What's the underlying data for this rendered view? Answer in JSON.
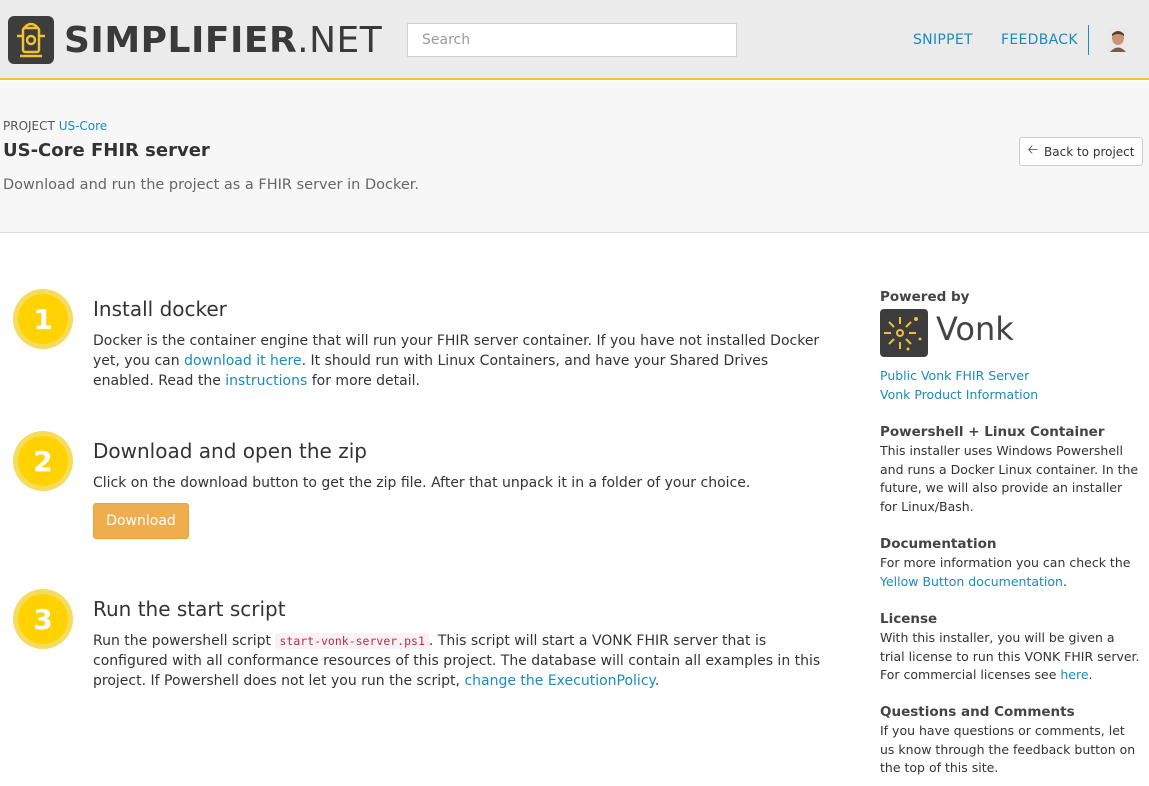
{
  "header": {
    "logo_bold": "SIMPLIFIER",
    "logo_light": ".NET",
    "search_placeholder": "Search",
    "nav": {
      "snippet": "SNIPPET",
      "feedback": "FEEDBACK"
    },
    "icons": {
      "logo": "hydrant-logo-icon",
      "avatar": "user-avatar"
    }
  },
  "project": {
    "crumb_label": "PROJECT",
    "crumb_link": "US-Core",
    "title": "US-Core FHIR server",
    "subtitle": "Download and run the project as a FHIR server in Docker.",
    "back_label": "Back to project"
  },
  "steps": [
    {
      "number": "1",
      "title": "Install docker",
      "text_a": "Docker is the container engine that will run your FHIR server container. If you have not installed Docker yet, you can ",
      "link_a": "download it here",
      "text_b": ". It should run with Linux Containers, and have your Shared Drives enabled. Read the ",
      "link_b": "instructions",
      "text_c": " for more detail."
    },
    {
      "number": "2",
      "title": "Download and open the zip",
      "text_a": "Click on the download button to get the zip file. After that unpack it in a folder of your choice.",
      "button": "Download"
    },
    {
      "number": "3",
      "title": "Run the start script",
      "text_a": "Run the powershell script ",
      "code": "start-vonk-server.ps1",
      "text_b": ". This script will start a VONK FHIR server that is configured with all conformance resources of this project. The database will contain all examples in this project. If Powershell does not let you run the script, ",
      "link_a": "change the ExecutionPolicy",
      "text_c": "."
    }
  ],
  "sidebar": {
    "powered_by": "Powered by",
    "vonk": "Vonk",
    "links": [
      "Public Vonk FHIR Server",
      "Vonk Product Information"
    ],
    "sections": [
      {
        "title": "Powershell + Linux Container",
        "text_a": "This installer uses Windows Powershell and runs a Docker Linux container. In the future, we will also provide an installer for Linux/Bash."
      },
      {
        "title": "Documentation",
        "text_a": "For more information you can check the ",
        "link": "Yellow Button documentation",
        "text_b": "."
      },
      {
        "title": "License",
        "text_a": "With this installer, you will be given a trial license to run this VONK FHIR server. For commercial licenses see ",
        "link": "here",
        "text_b": "."
      },
      {
        "title": "Questions and Comments",
        "text_a": "If you have questions or comments, let us know through the feedback button on the top of this site."
      }
    ]
  },
  "colors": {
    "accent": "#f1c232",
    "link": "#1a8bbf",
    "step": "#ffd200",
    "download": "#f0ad4e"
  }
}
